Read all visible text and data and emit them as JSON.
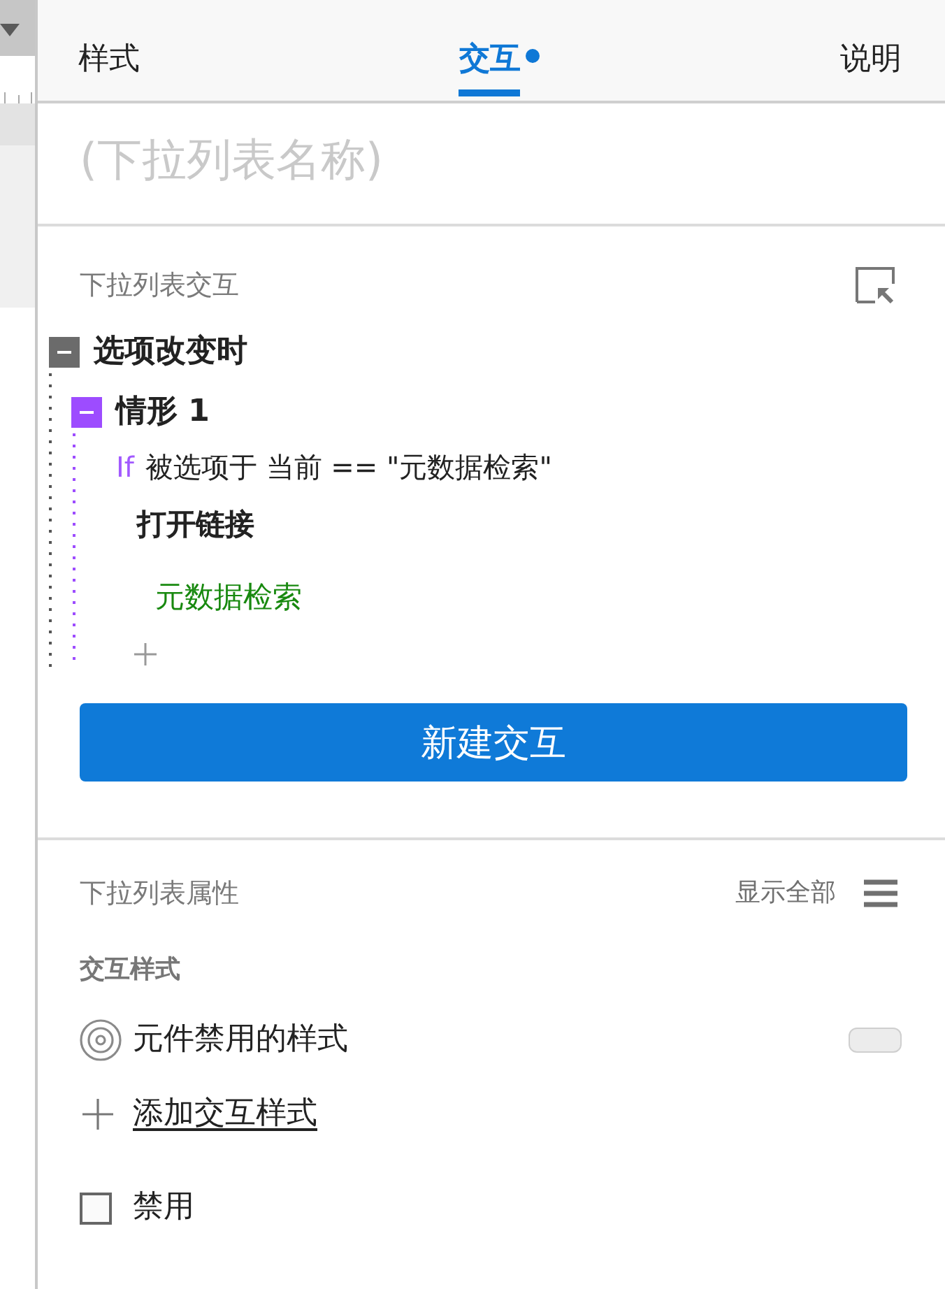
{
  "tabs": [
    {
      "label": "样式",
      "selected": false,
      "dot": false
    },
    {
      "label": "交互",
      "selected": true,
      "dot": true
    },
    {
      "label": "说明",
      "selected": false,
      "dot": false
    }
  ],
  "name_field": {
    "placeholder": "(下拉列表名称)"
  },
  "interactions": {
    "title": "下拉列表交互",
    "events": [
      {
        "label": "选项改变时",
        "expanded": true,
        "cases": [
          {
            "label": "情形 1",
            "expanded": true,
            "condition": {
              "keyword": "If",
              "text": "被选项于 当前 == \"元数据检索\""
            },
            "actions": [
              {
                "label": "打开链接",
                "targets": [
                  "元数据检索"
                ]
              }
            ]
          }
        ]
      }
    ],
    "new_button": "新建交互"
  },
  "properties": {
    "title": "下拉列表属性",
    "show_all": "显示全部",
    "styles_heading": "交互样式",
    "styles": [
      {
        "label": "元件禁用的样式"
      }
    ],
    "add_style": "添加交互样式",
    "options": [
      {
        "label": "禁用",
        "checked": false
      }
    ]
  }
}
